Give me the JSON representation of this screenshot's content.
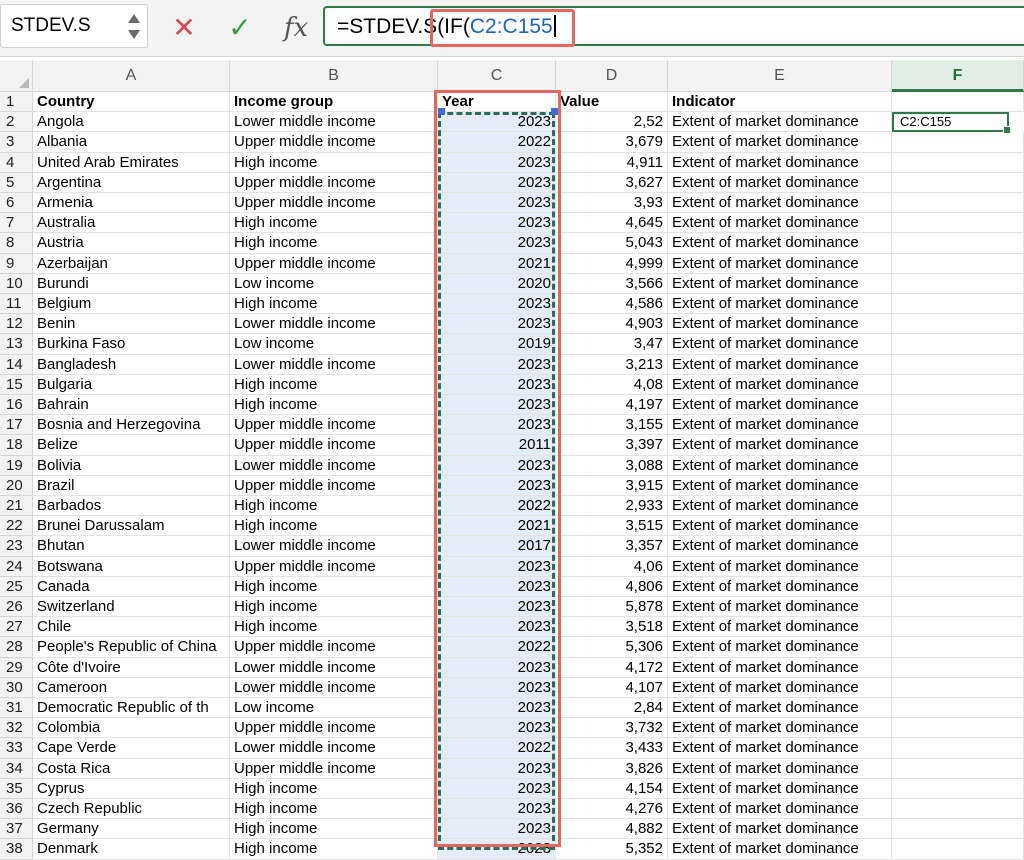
{
  "formula_bar": {
    "name_box": "STDEV.S",
    "cancel_symbol": "✕",
    "enter_symbol": "✓",
    "fx_label": "fx",
    "formula_prefix": "=STDEV.S(IF(",
    "formula_ref": "C2:C155",
    "colors": {
      "ref": "#1e63c8",
      "highlight": "#e5665e",
      "active": "#2e7a4a"
    }
  },
  "columns": [
    {
      "letter": "A",
      "width": 197
    },
    {
      "letter": "B",
      "width": 208
    },
    {
      "letter": "C",
      "width": 118
    },
    {
      "letter": "D",
      "width": 112
    },
    {
      "letter": "E",
      "width": 224
    },
    {
      "letter": "F",
      "width": 132
    }
  ],
  "active_column": "F",
  "active_cell_text": "C2:C155",
  "header_row": {
    "row": "1",
    "country": "Country",
    "income": "Income group",
    "year": "Year",
    "value": "Value",
    "indicator": "Indicator"
  },
  "rows": [
    {
      "n": "2",
      "country": "Angola",
      "income": "Lower middle income",
      "year": "2023",
      "value": "2,52",
      "indicator": "Extent of market dominance"
    },
    {
      "n": "3",
      "country": "Albania",
      "income": "Upper middle income",
      "year": "2022",
      "value": "3,679",
      "indicator": "Extent of market dominance"
    },
    {
      "n": "4",
      "country": "United Arab Emirates",
      "income": "High income",
      "year": "2023",
      "value": "4,911",
      "indicator": "Extent of market dominance"
    },
    {
      "n": "5",
      "country": "Argentina",
      "income": "Upper middle income",
      "year": "2023",
      "value": "3,627",
      "indicator": "Extent of market dominance"
    },
    {
      "n": "6",
      "country": "Armenia",
      "income": "Upper middle income",
      "year": "2023",
      "value": "3,93",
      "indicator": "Extent of market dominance"
    },
    {
      "n": "7",
      "country": "Australia",
      "income": "High income",
      "year": "2023",
      "value": "4,645",
      "indicator": "Extent of market dominance"
    },
    {
      "n": "8",
      "country": "Austria",
      "income": "High income",
      "year": "2023",
      "value": "5,043",
      "indicator": "Extent of market dominance"
    },
    {
      "n": "9",
      "country": "Azerbaijan",
      "income": "Upper middle income",
      "year": "2021",
      "value": "4,999",
      "indicator": "Extent of market dominance"
    },
    {
      "n": "10",
      "country": "Burundi",
      "income": "Low income",
      "year": "2020",
      "value": "3,566",
      "indicator": "Extent of market dominance"
    },
    {
      "n": "11",
      "country": "Belgium",
      "income": "High income",
      "year": "2023",
      "value": "4,586",
      "indicator": "Extent of market dominance"
    },
    {
      "n": "12",
      "country": "Benin",
      "income": "Lower middle income",
      "year": "2023",
      "value": "4,903",
      "indicator": "Extent of market dominance"
    },
    {
      "n": "13",
      "country": "Burkina Faso",
      "income": "Low income",
      "year": "2019",
      "value": "3,47",
      "indicator": "Extent of market dominance"
    },
    {
      "n": "14",
      "country": "Bangladesh",
      "income": "Lower middle income",
      "year": "2023",
      "value": "3,213",
      "indicator": "Extent of market dominance"
    },
    {
      "n": "15",
      "country": "Bulgaria",
      "income": "High income",
      "year": "2023",
      "value": "4,08",
      "indicator": "Extent of market dominance"
    },
    {
      "n": "16",
      "country": "Bahrain",
      "income": "High income",
      "year": "2023",
      "value": "4,197",
      "indicator": "Extent of market dominance"
    },
    {
      "n": "17",
      "country": "Bosnia and Herzegovina",
      "income": "Upper middle income",
      "year": "2023",
      "value": "3,155",
      "indicator": "Extent of market dominance"
    },
    {
      "n": "18",
      "country": "Belize",
      "income": "Upper middle income",
      "year": "2011",
      "value": "3,397",
      "indicator": "Extent of market dominance"
    },
    {
      "n": "19",
      "country": "Bolivia",
      "income": "Lower middle income",
      "year": "2023",
      "value": "3,088",
      "indicator": "Extent of market dominance"
    },
    {
      "n": "20",
      "country": "Brazil",
      "income": "Upper middle income",
      "year": "2023",
      "value": "3,915",
      "indicator": "Extent of market dominance"
    },
    {
      "n": "21",
      "country": "Barbados",
      "income": "High income",
      "year": "2022",
      "value": "2,933",
      "indicator": "Extent of market dominance"
    },
    {
      "n": "22",
      "country": "Brunei Darussalam",
      "income": "High income",
      "year": "2021",
      "value": "3,515",
      "indicator": "Extent of market dominance"
    },
    {
      "n": "23",
      "country": "Bhutan",
      "income": "Lower middle income",
      "year": "2017",
      "value": "3,357",
      "indicator": "Extent of market dominance"
    },
    {
      "n": "24",
      "country": "Botswana",
      "income": "Upper middle income",
      "year": "2023",
      "value": "4,06",
      "indicator": "Extent of market dominance"
    },
    {
      "n": "25",
      "country": "Canada",
      "income": "High income",
      "year": "2023",
      "value": "4,806",
      "indicator": "Extent of market dominance"
    },
    {
      "n": "26",
      "country": "Switzerland",
      "income": "High income",
      "year": "2023",
      "value": "5,878",
      "indicator": "Extent of market dominance"
    },
    {
      "n": "27",
      "country": "Chile",
      "income": "High income",
      "year": "2023",
      "value": "3,518",
      "indicator": "Extent of market dominance"
    },
    {
      "n": "28",
      "country": "People's Republic of China",
      "income": "Upper middle income",
      "year": "2022",
      "value": "5,306",
      "indicator": "Extent of market dominance"
    },
    {
      "n": "29",
      "country": "Côte d'Ivoire",
      "income": "Lower middle income",
      "year": "2023",
      "value": "4,172",
      "indicator": "Extent of market dominance"
    },
    {
      "n": "30",
      "country": "Cameroon",
      "income": "Lower middle income",
      "year": "2023",
      "value": "4,107",
      "indicator": "Extent of market dominance"
    },
    {
      "n": "31",
      "country": "Democratic Republic of th",
      "income": "Low income",
      "year": "2023",
      "value": "2,84",
      "indicator": "Extent of market dominance"
    },
    {
      "n": "32",
      "country": "Colombia",
      "income": "Upper middle income",
      "year": "2023",
      "value": "3,732",
      "indicator": "Extent of market dominance"
    },
    {
      "n": "33",
      "country": "Cape Verde",
      "income": "Lower middle income",
      "year": "2022",
      "value": "3,433",
      "indicator": "Extent of market dominance"
    },
    {
      "n": "34",
      "country": "Costa Rica",
      "income": "Upper middle income",
      "year": "2023",
      "value": "3,826",
      "indicator": "Extent of market dominance"
    },
    {
      "n": "35",
      "country": "Cyprus",
      "income": "High income",
      "year": "2023",
      "value": "4,154",
      "indicator": "Extent of market dominance"
    },
    {
      "n": "36",
      "country": "Czech Republic",
      "income": "High income",
      "year": "2023",
      "value": "4,276",
      "indicator": "Extent of market dominance"
    },
    {
      "n": "37",
      "country": "Germany",
      "income": "High income",
      "year": "2023",
      "value": "4,882",
      "indicator": "Extent of market dominance"
    },
    {
      "n": "38",
      "country": "Denmark",
      "income": "High income",
      "year": "2023",
      "value": "5,352",
      "indicator": "Extent of market dominance"
    }
  ]
}
